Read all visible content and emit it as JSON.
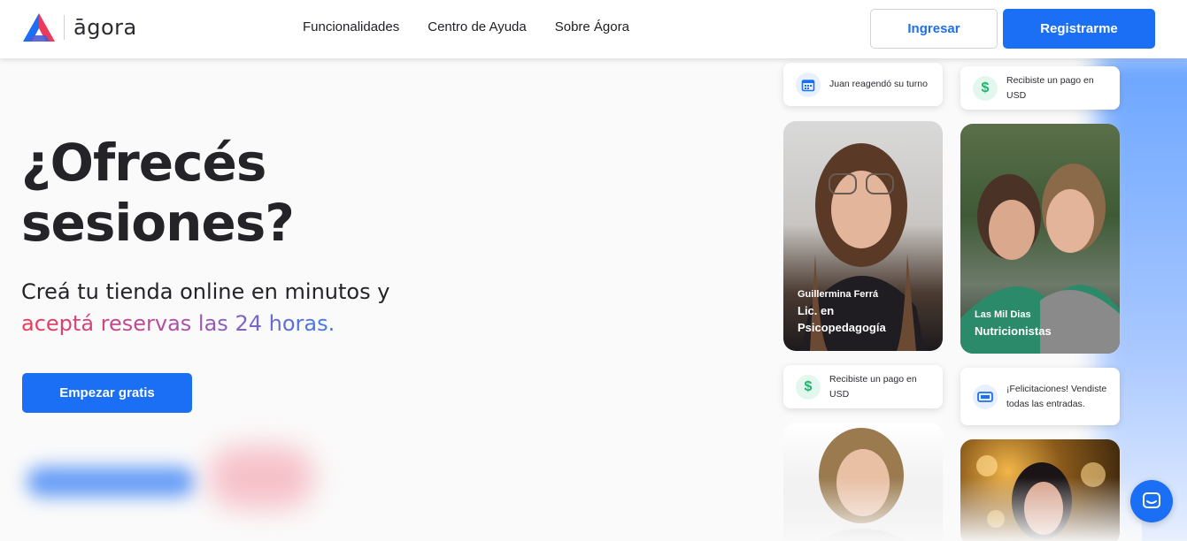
{
  "header": {
    "logo_text": "āgora",
    "nav": [
      "Funcionalidades",
      "Centro de Ayuda",
      "Sobre Ágora"
    ],
    "login_label": "Ingresar",
    "register_label": "Registrarme"
  },
  "hero": {
    "title_line1": "¿Ofrecés",
    "title_line2": "sesiones?",
    "subtitle_line1": "Creá tu tienda online en minutos y",
    "subtitle_line2": "aceptá reservas las 24 horas.",
    "cta_label": "Empezar gratis"
  },
  "notifications": [
    {
      "icon": "calendar-icon",
      "text": "Juan reagendó su turno"
    },
    {
      "icon": "dollar-icon",
      "text": "Recibiste un pago en USD"
    },
    {
      "icon": "dollar-icon",
      "text": "Recibiste un pago en USD"
    },
    {
      "icon": "ticket-icon",
      "text": "¡Felicitaciones! Vendiste todas las entradas."
    }
  ],
  "profiles": [
    {
      "name": "Guillermina Ferrá",
      "role": "Lic. en Psicopedagogía"
    },
    {
      "name": "Las Mil Dias",
      "role": "Nutricionistas"
    }
  ],
  "colors": {
    "primary": "#1a6ff5",
    "gradient_start": "#ec3b5a",
    "gradient_end": "#3f7be8",
    "success": "#1fb46e"
  }
}
